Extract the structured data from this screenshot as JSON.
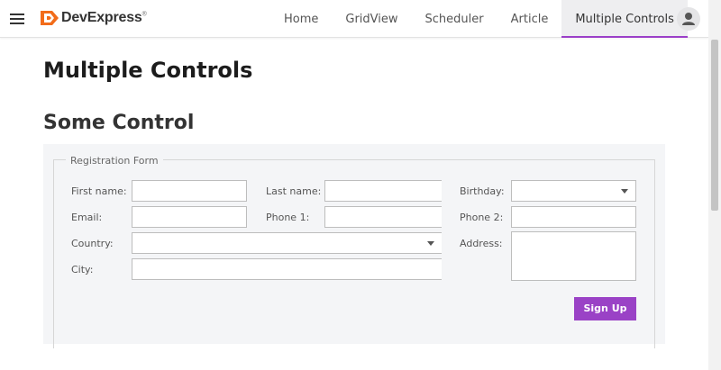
{
  "header": {
    "logo_text": "DevExpress",
    "logo_reg": "®",
    "nav": [
      {
        "label": "Home"
      },
      {
        "label": "GridView"
      },
      {
        "label": "Scheduler"
      },
      {
        "label": "Article"
      },
      {
        "label": "Multiple Controls",
        "active": true
      }
    ]
  },
  "main": {
    "page_title": "Multiple Controls",
    "section_title": "Some Control"
  },
  "form": {
    "legend": "Registration Form",
    "first_name_label": "First name:",
    "last_name_label": "Last name:",
    "birthday_label": "Birthday:",
    "email_label": "Email:",
    "phone1_label": "Phone 1:",
    "phone2_label": "Phone 2:",
    "country_label": "Country:",
    "address_label": "Address:",
    "city_label": "City:",
    "values": {
      "first_name": "",
      "last_name": "",
      "birthday": "",
      "email": "",
      "phone1": "",
      "phone2": "",
      "country": "",
      "address": "",
      "city": ""
    },
    "signup_label": "Sign Up"
  },
  "colors": {
    "accent": "#9a42c6",
    "panel_bg": "#f4f5f7"
  },
  "icons": [
    "hamburger-menu-icon",
    "devexpress-logo-icon",
    "user-avatar-icon",
    "dropdown-caret-icon"
  ]
}
